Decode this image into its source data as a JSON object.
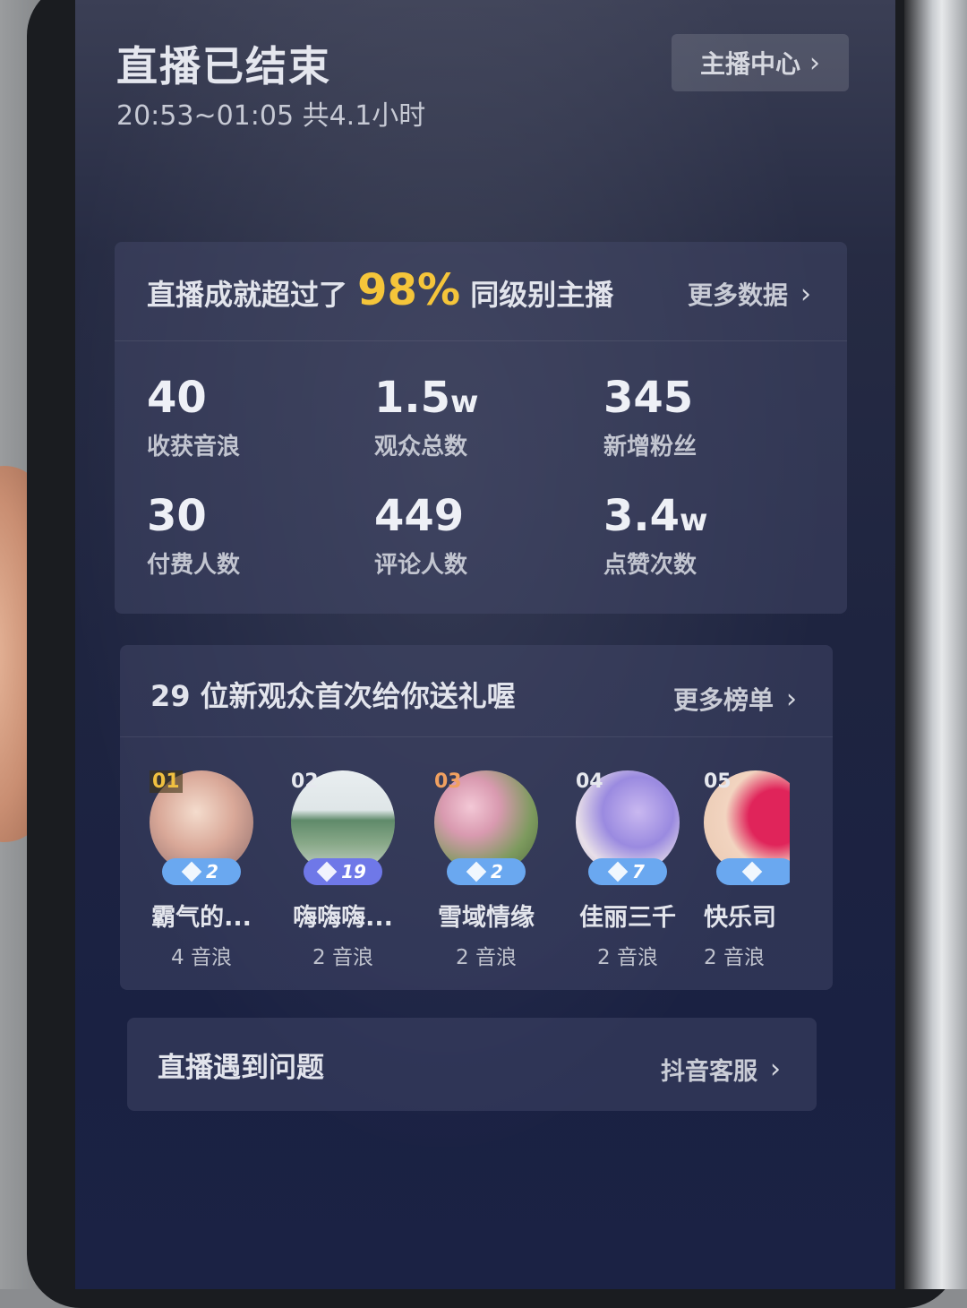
{
  "header": {
    "title": "直播已结束",
    "time_range": "20:53~01:05 共4.1小时",
    "anchor_center_label": "主播中心"
  },
  "achievement": {
    "prefix": "直播成就超过了",
    "percent": "98%",
    "suffix": "同级别主播",
    "more_data_label": "更多数据"
  },
  "stats": [
    {
      "value": "40",
      "unit": "",
      "label": "收获音浪"
    },
    {
      "value": "1.5",
      "unit": "w",
      "label": "观众总数"
    },
    {
      "value": "345",
      "unit": "",
      "label": "新增粉丝"
    },
    {
      "value": "30",
      "unit": "",
      "label": "付费人数"
    },
    {
      "value": "449",
      "unit": "",
      "label": "评论人数"
    },
    {
      "value": "3.4",
      "unit": "w",
      "label": "点赞次数"
    }
  ],
  "gifts": {
    "title": "29 位新观众首次给你送礼喔",
    "more_list_label": "更多榜单",
    "viewers": [
      {
        "rank": "01",
        "level": "2",
        "name": "霸气的...",
        "points": "4 音浪"
      },
      {
        "rank": "02",
        "level": "19",
        "name": "嗨嗨嗨...",
        "points": "2 音浪"
      },
      {
        "rank": "03",
        "level": "2",
        "name": "雪域情缘",
        "points": "2 音浪"
      },
      {
        "rank": "04",
        "level": "7",
        "name": "佳丽三千",
        "points": "2 音浪"
      },
      {
        "rank": "05",
        "level": "",
        "name": "快乐司",
        "points": "2 音浪"
      }
    ]
  },
  "problem": {
    "label": "直播遇到问题",
    "support_label": "抖音客服"
  },
  "colors": {
    "accent_percent": "#f5c53a",
    "badge_blue": "#6aa8f0",
    "badge_purple": "#6f78e8"
  }
}
